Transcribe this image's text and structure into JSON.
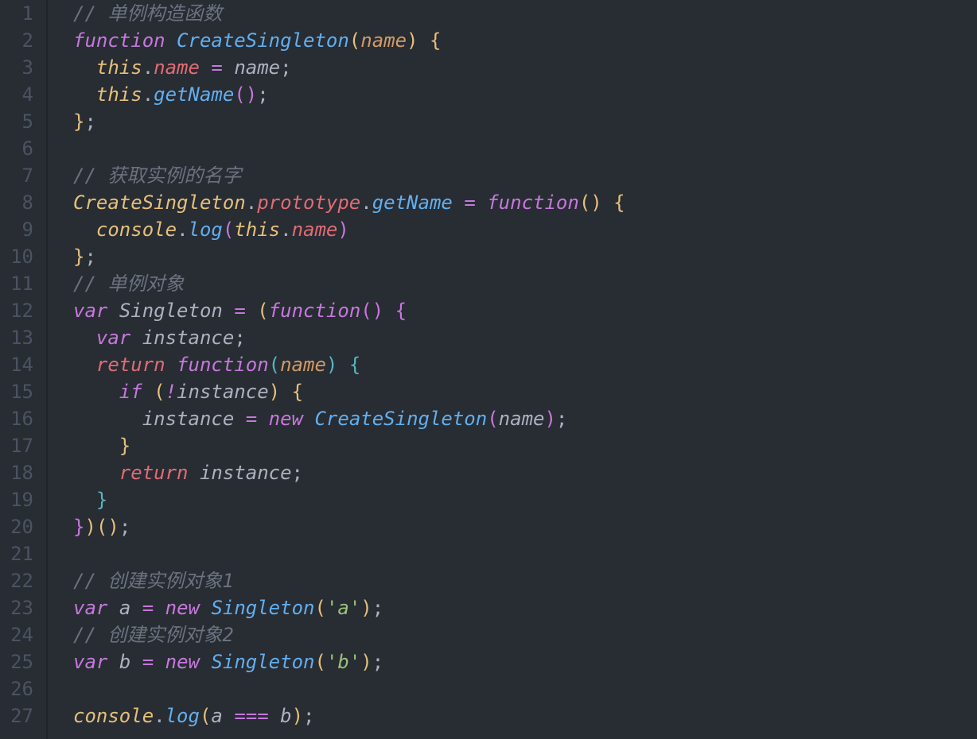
{
  "language": "javascript",
  "active_line_index": 0,
  "line_numbers": [
    "1",
    "2",
    "3",
    "4",
    "5",
    "6",
    "7",
    "8",
    "9",
    "10",
    "11",
    "12",
    "13",
    "14",
    "15",
    "16",
    "17",
    "18",
    "19",
    "20",
    "21",
    "22",
    "23",
    "24",
    "25",
    "26",
    "27"
  ],
  "lines": [
    [
      [
        "cm",
        "// 单例构造函数"
      ]
    ],
    [
      [
        "kw",
        "function"
      ],
      [
        "pn",
        " "
      ],
      [
        "fn",
        "CreateSingleton"
      ],
      [
        "pny",
        "("
      ],
      [
        "prm",
        "name"
      ],
      [
        "pny",
        ")"
      ],
      [
        "pn",
        " "
      ],
      [
        "pny",
        "{"
      ]
    ],
    [
      [
        "pn",
        "  "
      ],
      [
        "this",
        "this"
      ],
      [
        "pn",
        "."
      ],
      [
        "prop",
        "name"
      ],
      [
        "pn",
        " "
      ],
      [
        "op",
        "="
      ],
      [
        "pn",
        " "
      ],
      [
        "id",
        "name"
      ],
      [
        "pn",
        ";"
      ]
    ],
    [
      [
        "pn",
        "  "
      ],
      [
        "this",
        "this"
      ],
      [
        "pn",
        "."
      ],
      [
        "fn",
        "getName"
      ],
      [
        "pnp",
        "("
      ],
      [
        "pnp",
        ")"
      ],
      [
        "pn",
        ";"
      ]
    ],
    [
      [
        "pny",
        "}"
      ],
      [
        "pn",
        ";"
      ]
    ],
    [],
    [
      [
        "cm",
        "// 获取实例的名字"
      ]
    ],
    [
      [
        "cls",
        "CreateSingleton"
      ],
      [
        "pn",
        "."
      ],
      [
        "prop",
        "prototype"
      ],
      [
        "pn",
        "."
      ],
      [
        "fn",
        "getName"
      ],
      [
        "pn",
        " "
      ],
      [
        "op",
        "="
      ],
      [
        "pn",
        " "
      ],
      [
        "kw",
        "function"
      ],
      [
        "pny",
        "("
      ],
      [
        "pny",
        ")"
      ],
      [
        "pn",
        " "
      ],
      [
        "pny",
        "{"
      ]
    ],
    [
      [
        "pn",
        "  "
      ],
      [
        "glb",
        "console"
      ],
      [
        "pn",
        "."
      ],
      [
        "fn",
        "log"
      ],
      [
        "pnp",
        "("
      ],
      [
        "this",
        "this"
      ],
      [
        "pn",
        "."
      ],
      [
        "prop",
        "name"
      ],
      [
        "pnp",
        ")"
      ]
    ],
    [
      [
        "pny",
        "}"
      ],
      [
        "pn",
        ";"
      ]
    ],
    [
      [
        "cm",
        "// 单例对象"
      ]
    ],
    [
      [
        "kw",
        "var"
      ],
      [
        "pn",
        " "
      ],
      [
        "id",
        "Singleton"
      ],
      [
        "pn",
        " "
      ],
      [
        "op",
        "="
      ],
      [
        "pn",
        " "
      ],
      [
        "pny",
        "("
      ],
      [
        "kw",
        "function"
      ],
      [
        "pnp",
        "("
      ],
      [
        "pnp",
        ")"
      ],
      [
        "pn",
        " "
      ],
      [
        "pnp",
        "{"
      ]
    ],
    [
      [
        "pn",
        "  "
      ],
      [
        "kw",
        "var"
      ],
      [
        "pn",
        " "
      ],
      [
        "id",
        "instance"
      ],
      [
        "pn",
        ";"
      ]
    ],
    [
      [
        "pn",
        "  "
      ],
      [
        "ret",
        "return"
      ],
      [
        "pn",
        " "
      ],
      [
        "kw",
        "function"
      ],
      [
        "pnb",
        "("
      ],
      [
        "prm",
        "name"
      ],
      [
        "pnb",
        ")"
      ],
      [
        "pn",
        " "
      ],
      [
        "pnb",
        "{"
      ]
    ],
    [
      [
        "pn",
        "    "
      ],
      [
        "kw",
        "if"
      ],
      [
        "pn",
        " "
      ],
      [
        "pny",
        "("
      ],
      [
        "op",
        "!"
      ],
      [
        "id",
        "instance"
      ],
      [
        "pny",
        ")"
      ],
      [
        "pn",
        " "
      ],
      [
        "pny",
        "{"
      ]
    ],
    [
      [
        "pn",
        "      "
      ],
      [
        "id",
        "instance"
      ],
      [
        "pn",
        " "
      ],
      [
        "op",
        "="
      ],
      [
        "pn",
        " "
      ],
      [
        "kw",
        "new"
      ],
      [
        "pn",
        " "
      ],
      [
        "fn",
        "CreateSingleton"
      ],
      [
        "pnp",
        "("
      ],
      [
        "id",
        "name"
      ],
      [
        "pnp",
        ")"
      ],
      [
        "pn",
        ";"
      ]
    ],
    [
      [
        "pn",
        "    "
      ],
      [
        "pny",
        "}"
      ]
    ],
    [
      [
        "pn",
        "    "
      ],
      [
        "ret",
        "return"
      ],
      [
        "pn",
        " "
      ],
      [
        "id",
        "instance"
      ],
      [
        "pn",
        ";"
      ]
    ],
    [
      [
        "pn",
        "  "
      ],
      [
        "pnb",
        "}"
      ]
    ],
    [
      [
        "pnp",
        "}"
      ],
      [
        "pny",
        ")"
      ],
      [
        "pny",
        "("
      ],
      [
        "pny",
        ")"
      ],
      [
        "pn",
        ";"
      ]
    ],
    [],
    [
      [
        "cm",
        "// 创建实例对象1"
      ]
    ],
    [
      [
        "kw",
        "var"
      ],
      [
        "pn",
        " "
      ],
      [
        "id",
        "a"
      ],
      [
        "pn",
        " "
      ],
      [
        "op",
        "="
      ],
      [
        "pn",
        " "
      ],
      [
        "kw",
        "new"
      ],
      [
        "pn",
        " "
      ],
      [
        "fn",
        "Singleton"
      ],
      [
        "pny",
        "("
      ],
      [
        "str",
        "'a'"
      ],
      [
        "pny",
        ")"
      ],
      [
        "pn",
        ";"
      ]
    ],
    [
      [
        "cm",
        "// 创建实例对象2"
      ]
    ],
    [
      [
        "kw",
        "var"
      ],
      [
        "pn",
        " "
      ],
      [
        "id",
        "b"
      ],
      [
        "pn",
        " "
      ],
      [
        "op",
        "="
      ],
      [
        "pn",
        " "
      ],
      [
        "kw",
        "new"
      ],
      [
        "pn",
        " "
      ],
      [
        "fn",
        "Singleton"
      ],
      [
        "pny",
        "("
      ],
      [
        "str",
        "'b'"
      ],
      [
        "pny",
        ")"
      ],
      [
        "pn",
        ";"
      ]
    ],
    [],
    [
      [
        "glb",
        "console"
      ],
      [
        "pn",
        "."
      ],
      [
        "fn",
        "log"
      ],
      [
        "pny",
        "("
      ],
      [
        "id",
        "a"
      ],
      [
        "pn",
        " "
      ],
      [
        "op",
        "==="
      ],
      [
        "pn",
        " "
      ],
      [
        "id",
        "b"
      ],
      [
        "pny",
        ")"
      ],
      [
        "pn",
        ";"
      ]
    ]
  ]
}
